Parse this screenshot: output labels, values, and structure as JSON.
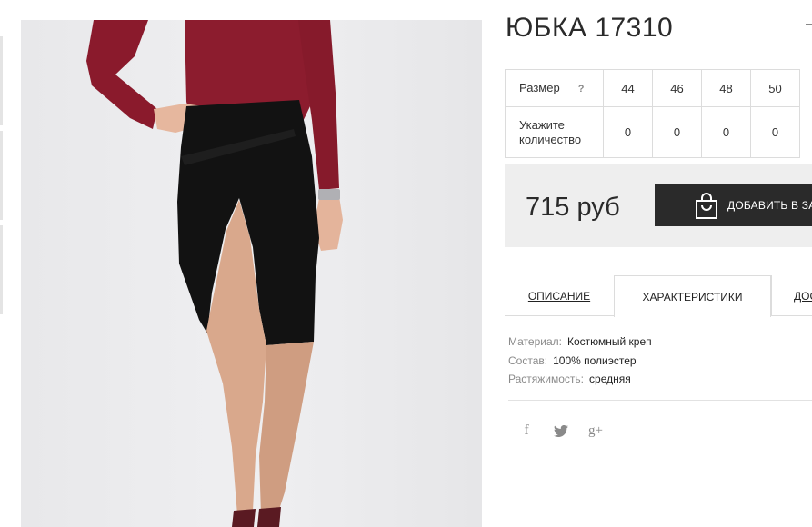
{
  "product": {
    "title": "ЮБКА 17310"
  },
  "sizes": {
    "size_label": "Размер",
    "help": "?",
    "qty_label": "Укажите количество",
    "columns": [
      "44",
      "46",
      "48",
      "50"
    ],
    "quantities": [
      "0",
      "0",
      "0",
      "0"
    ]
  },
  "purchase": {
    "price": "715 руб",
    "add_to_cart": "ДОБАВИТЬ В ЗА"
  },
  "tabs": {
    "description": "ОПИСАНИЕ",
    "characteristics": "ХАРАКТЕРИСТИКИ",
    "delivery": "ДОС"
  },
  "specs": [
    {
      "key": "Материал:",
      "value": "Костюмный креп"
    },
    {
      "key": "Состав:",
      "value": "100% полиэстер"
    },
    {
      "key": "Растяжимость:",
      "value": "средняя"
    }
  ],
  "social": {
    "facebook": "f",
    "twitter": "twitter-icon",
    "googleplus": "g+"
  },
  "colors": {
    "button_bg": "#2a2a2a",
    "price_box_bg": "#eeeeee",
    "sweater": "#8c1c2e",
    "skirt": "#111111"
  }
}
